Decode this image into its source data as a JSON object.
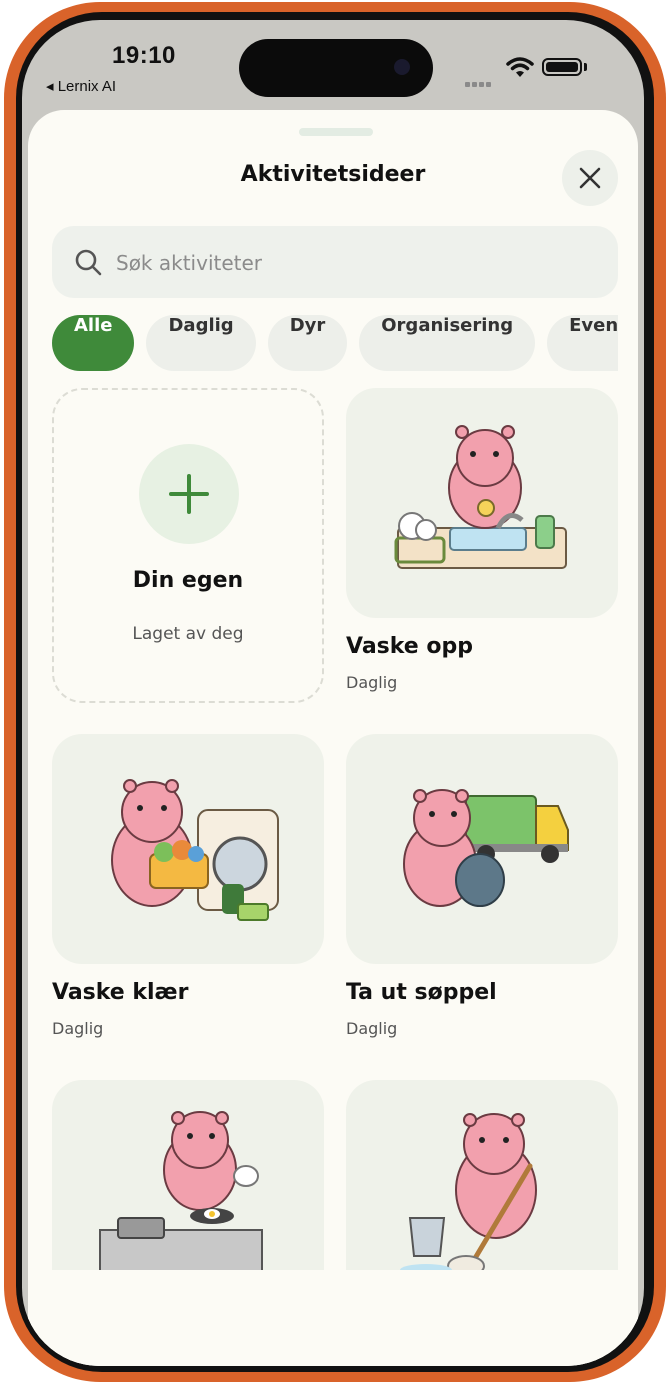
{
  "status": {
    "time": "19:10",
    "back_app": "Lernix AI"
  },
  "sheet": {
    "title": "Aktivitetsideer"
  },
  "search": {
    "placeholder": "Søk aktiviteter"
  },
  "filters": [
    "Alle",
    "Daglig",
    "Dyr",
    "Organisering",
    "Event"
  ],
  "active_filter": "Alle",
  "own": {
    "title": "Din egen",
    "subtitle": "Laget av deg"
  },
  "activities": [
    {
      "name": "Vaske opp",
      "category": "Daglig",
      "icon": "hippo-washing-dishes-illustration"
    },
    {
      "name": "Vaske klær",
      "category": "Daglig",
      "icon": "hippo-laundry-illustration"
    },
    {
      "name": "Ta ut søppel",
      "category": "Daglig",
      "icon": "hippo-trash-truck-illustration"
    },
    {
      "name": "",
      "category": "",
      "icon": "hippo-cooking-illustration"
    },
    {
      "name": "",
      "category": "",
      "icon": "hippo-mopping-illustration"
    }
  ],
  "colors": {
    "accent": "#3f8a3a",
    "frame": "#d9632a",
    "sheet_bg": "#fcfbf5",
    "card_bg": "#eff2ea",
    "hippo": "#f2a0ad"
  }
}
